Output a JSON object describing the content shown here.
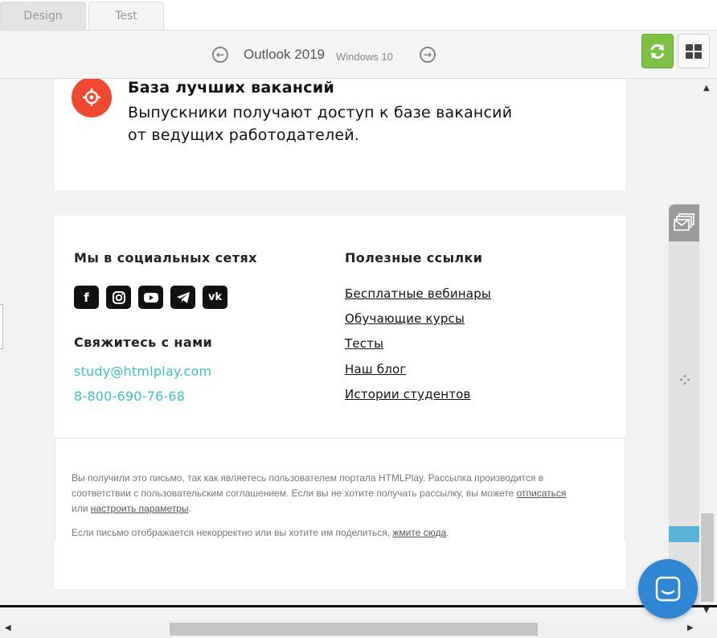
{
  "tabs": {
    "design": "Design",
    "test": "Test"
  },
  "toolbar": {
    "client": "Outlook 2019",
    "os": "Windows 10",
    "prev_icon": "arrow-left-circle-icon",
    "next_icon": "arrow-right-circle-icon",
    "refresh_icon": "refresh-icon",
    "grid_icon": "grid-icon"
  },
  "email": {
    "feature": {
      "title": "База лучших вакансий",
      "line1": "Выпускники получают доступ к базе вакансий",
      "line2": "от ведущих работодателей.",
      "icon": "target-icon"
    },
    "footer": {
      "social_title": "Мы в социальных сетях",
      "social_icons": [
        "facebook-icon",
        "instagram-icon",
        "youtube-icon",
        "telegram-icon",
        "vk-icon"
      ],
      "contact_title": "Свяжитесь с нами",
      "email": "study@htmlplay.com",
      "phone": "8-800-690-76-68",
      "links_title": "Полезные ссылки",
      "links": [
        "Бесплатные вебинары",
        "Обучающие курсы",
        "Тесты",
        "Наш блог",
        "Истории студентов"
      ]
    },
    "legal": {
      "p1_a": "Вы получили это письмо, так как являетесь пользователем портала HTMLPlay. Рассылка производится в соответствии с пользовательским соглашением. Если вы не хотите получать рассылку, вы можете ",
      "unsubscribe": "отписаться",
      "p1_b": " или ",
      "settings": "настроить параметры",
      "p1_c": ".",
      "p2_a": "Если письмо отображается некорректно или вы хотите им поделиться, ",
      "click_here": "жмите сюда",
      "p2_b": "."
    }
  },
  "colors": {
    "accent_green": "#7cc144",
    "pin_red": "#f0492f",
    "link_teal": "#3cc2c6",
    "chat_blue": "#2f86d2"
  }
}
